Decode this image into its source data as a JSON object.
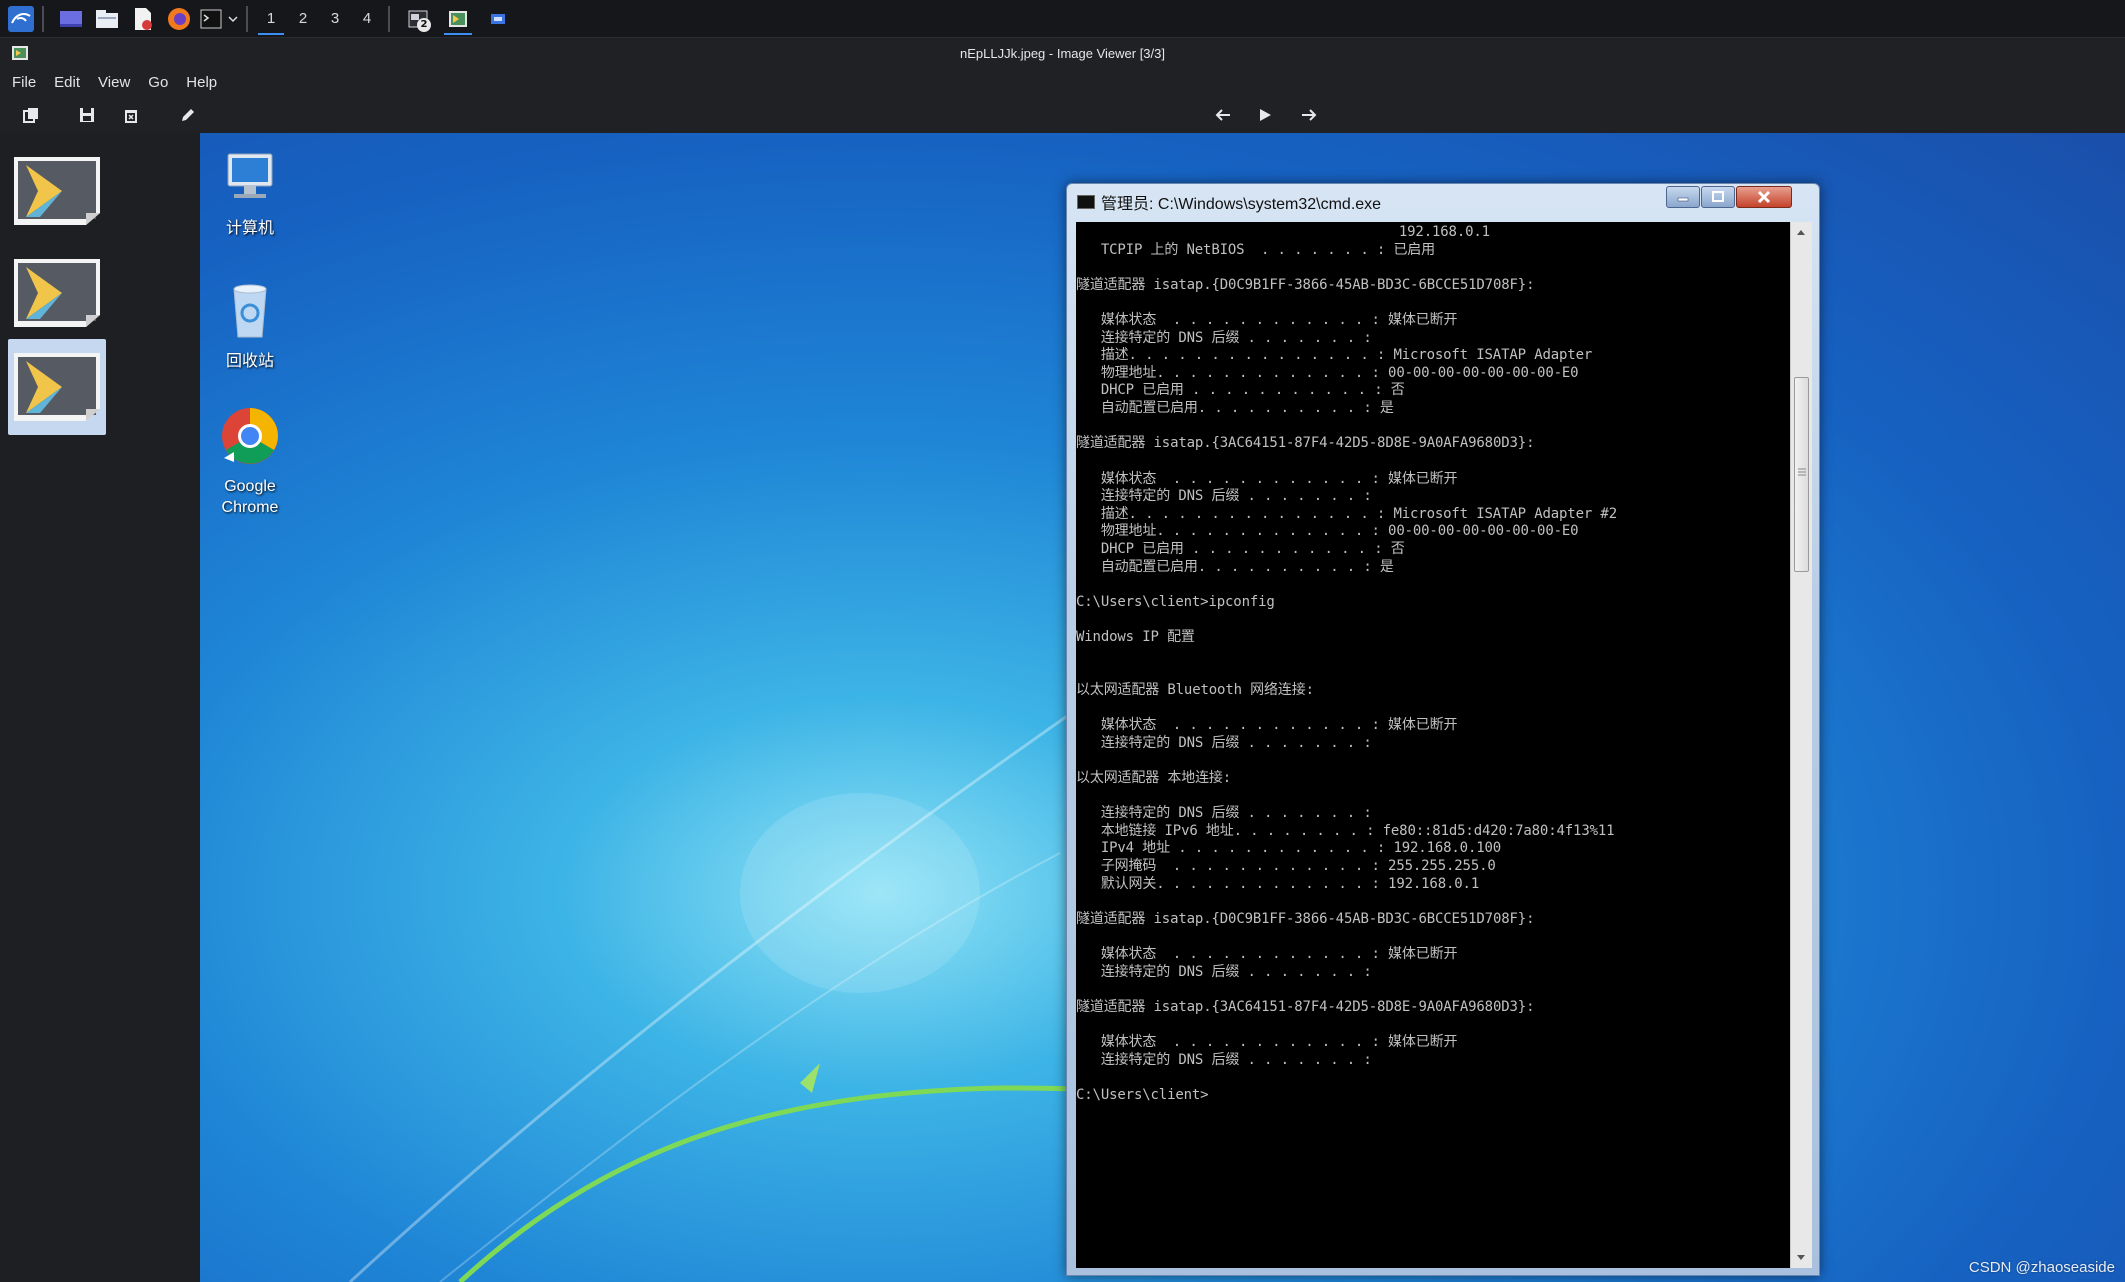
{
  "taskbar": {
    "workspaces": [
      "1",
      "2",
      "3",
      "4"
    ],
    "active_workspace": "1",
    "task_badge": "2"
  },
  "viewer": {
    "title": "nEpLLJJk.jpeg - Image Viewer [3/3]",
    "menu": [
      "File",
      "Edit",
      "View",
      "Go",
      "Help"
    ]
  },
  "desktop": {
    "icons": [
      "计算机",
      "回收站",
      "Google Chrome"
    ]
  },
  "cmd": {
    "title": "管理员: C:\\Windows\\system32\\cmd.exe",
    "lines": [
      "                                       192.168.0.1",
      "   TCPIP 上的 NetBIOS  . . . . . . . : 已启用",
      "",
      "隧道适配器 isatap.{D0C9B1FF-3866-45AB-BD3C-6BCCE51D708F}:",
      "",
      "   媒体状态  . . . . . . . . . . . . : 媒体已断开",
      "   连接特定的 DNS 后缀 . . . . . . . :",
      "   描述. . . . . . . . . . . . . . . : Microsoft ISATAP Adapter",
      "   物理地址. . . . . . . . . . . . . : 00-00-00-00-00-00-00-E0",
      "   DHCP 已启用 . . . . . . . . . . . : 否",
      "   自动配置已启用. . . . . . . . . . : 是",
      "",
      "隧道适配器 isatap.{3AC64151-87F4-42D5-8D8E-9A0AFA9680D3}:",
      "",
      "   媒体状态  . . . . . . . . . . . . : 媒体已断开",
      "   连接特定的 DNS 后缀 . . . . . . . :",
      "   描述. . . . . . . . . . . . . . . : Microsoft ISATAP Adapter #2",
      "   物理地址. . . . . . . . . . . . . : 00-00-00-00-00-00-00-E0",
      "   DHCP 已启用 . . . . . . . . . . . : 否",
      "   自动配置已启用. . . . . . . . . . : 是",
      "",
      "C:\\Users\\client>ipconfig",
      "",
      "Windows IP 配置",
      "",
      "",
      "以太网适配器 Bluetooth 网络连接:",
      "",
      "   媒体状态  . . . . . . . . . . . . : 媒体已断开",
      "   连接特定的 DNS 后缀 . . . . . . . :",
      "",
      "以太网适配器 本地连接:",
      "",
      "   连接特定的 DNS 后缀 . . . . . . . :",
      "   本地链接 IPv6 地址. . . . . . . . : fe80::81d5:d420:7a80:4f13%11",
      "   IPv4 地址 . . . . . . . . . . . . : 192.168.0.100",
      "   子网掩码  . . . . . . . . . . . . : 255.255.255.0",
      "   默认网关. . . . . . . . . . . . . : 192.168.0.1",
      "",
      "隧道适配器 isatap.{D0C9B1FF-3866-45AB-BD3C-6BCCE51D708F}:",
      "",
      "   媒体状态  . . . . . . . . . . . . : 媒体已断开",
      "   连接特定的 DNS 后缀 . . . . . . . :",
      "",
      "隧道适配器 isatap.{3AC64151-87F4-42D5-8D8E-9A0AFA9680D3}:",
      "",
      "   媒体状态  . . . . . . . . . . . . : 媒体已断开",
      "   连接特定的 DNS 后缀 . . . . . . . :",
      "",
      "C:\\Users\\client>"
    ]
  },
  "watermark": "CSDN @zhaoseaside"
}
